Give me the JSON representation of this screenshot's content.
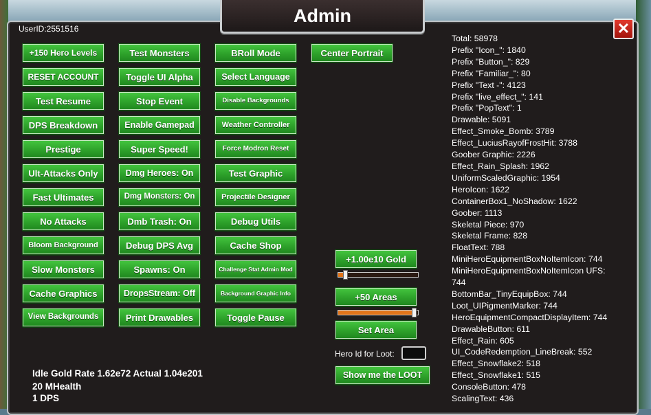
{
  "window": {
    "title": "Admin",
    "close_label": "✕",
    "user_id": "UserID:2551516"
  },
  "buttons_col1": [
    "+150 Hero Levels",
    "RESET ACCOUNT",
    "Test Resume",
    "DPS Breakdown",
    "Prestige",
    "Ult-Attacks Only",
    "Fast Ultimates",
    "No Attacks",
    "Bloom Background",
    "Slow Monsters",
    "Cache Graphics",
    "View Backgrounds"
  ],
  "buttons_col2": [
    "Test Monsters",
    "Toggle UI Alpha",
    "Stop Event",
    "Enable Gamepad",
    "Super Speed!",
    "Dmg Heroes: On",
    "Dmg Monsters: On",
    "Dmb Trash: On",
    "Debug DPS Avg",
    "Spawns: On",
    "DropsStream: Off",
    "Print Drawables"
  ],
  "buttons_col3": [
    "BRoll Mode",
    "Select Language",
    "Disable Backgrounds",
    "Weather Controller",
    "Force Modron Reset",
    "Test Graphic",
    "Projectile Designer",
    "Debug Utils",
    "Cache Shop",
    "Challenge Stat Admin Mod",
    "Background Graphic Info",
    "Toggle Pause"
  ],
  "buttons_col4": [
    "Center Portrait"
  ],
  "gold_controls": {
    "gold_button": "+1.00e10 Gold",
    "gold_slider_level": 0.06,
    "areas_button": "+50 Areas",
    "areas_slider_level": 0.97,
    "set_area_button": "Set Area",
    "hero_id_label": "Hero Id for Loot:",
    "hero_id_value": "",
    "show_loot_button": "Show me the LOOT"
  },
  "info": {
    "gold_rate": "Idle Gold Rate 1.62e72 Actual 1.04e201",
    "mhealth": "20 MHealth",
    "dps": "1 DPS"
  },
  "stats": [
    "Total: 58978",
    "Prefix \"Icon_\": 1840",
    "Prefix \"Button_\": 829",
    "Prefix \"Familiar_\": 80",
    "Prefix \"Text -\": 4123",
    "Prefix \"live_effect_\": 141",
    "Prefix \"PopText\": 1",
    "Drawable: 5091",
    "Effect_Smoke_Bomb: 3789",
    "Effect_LuciusRayofFrostHit: 3788",
    "Goober Graphic: 2226",
    "Effect_Rain_Splash: 1962",
    "UniformScaledGraphic: 1954",
    "HeroIcon: 1622",
    "ContainerBox1_NoShadow: 1622",
    "Goober: 1113",
    "Skeletal Piece: 970",
    "Skeletal Frame: 828",
    "FloatText: 788",
    "MiniHeroEquipmentBoxNoItemIcon: 744",
    "MiniHeroEquipmentBoxNoItemIcon UFS: 744",
    "BottomBar_TinyEquipBox: 744",
    "Loot_UIPigmentMarker: 744",
    "HeroEquipmentCompactDisplayItem: 744",
    "DrawableButton: 611",
    "Effect_Rain: 605",
    "UI_CodeRedemption_LineBreak: 552",
    "Effect_Snowflake2: 518",
    "Effect_Snowflake1: 515",
    "ConsoleButton: 478",
    "ScalingText: 436"
  ]
}
